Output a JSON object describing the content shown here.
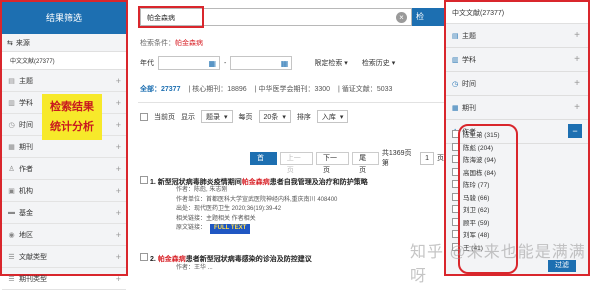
{
  "left": {
    "header": "结果筛选",
    "source_label": "来源",
    "count_label": "中文文献(27377)",
    "facets": [
      {
        "label": "主题",
        "icon": "topic-icon"
      },
      {
        "label": "学科",
        "icon": "book-icon"
      },
      {
        "label": "时间",
        "icon": "clock-icon"
      },
      {
        "label": "期刊",
        "icon": "journal-icon"
      },
      {
        "label": "作者",
        "icon": "person-icon"
      },
      {
        "label": "机构",
        "icon": "building-icon"
      },
      {
        "label": "基金",
        "icon": "fund-icon"
      },
      {
        "label": "地区",
        "icon": "location-icon"
      },
      {
        "label": "文献类型",
        "icon": "doc-icon"
      },
      {
        "label": "期刊类型",
        "icon": "doc-icon"
      }
    ],
    "annotation_line1": "检索结果",
    "annotation_line2": "统计分析"
  },
  "center": {
    "search_value": "帕金森病",
    "search_button": "检",
    "condition_prefix": "检索条件：",
    "condition_value": "帕金森病",
    "year_label": "年代",
    "year_dash": "-",
    "limit_label": "限定检索",
    "history_label": "检索历史",
    "stats": [
      {
        "label": "全部：",
        "value": "27377"
      },
      {
        "label": "核心期刊：",
        "value": "18896"
      },
      {
        "label": "中华医学会期刊：",
        "value": "3300"
      },
      {
        "label": "循证文献：",
        "value": "5033"
      }
    ],
    "toolbar": {
      "current_page": "当前页",
      "display": "显示",
      "display_value": "题录",
      "per_page": "每页",
      "per_page_value": "20条",
      "sort": "排序",
      "sort_value": "入库"
    },
    "pager": {
      "first": "首页",
      "prev": "上一页",
      "next": "下一页",
      "last": "尾页",
      "info": "共1369页 第",
      "page_value": "1",
      "page_unit": "页"
    },
    "records": [
      {
        "index": "1.",
        "title_pre": "新型冠状病毒肺炎疫情期间",
        "title_hl": "帕金森病",
        "title_post": "患者自我管理及治疗和防护策略",
        "meta": [
          {
            "k": "作者：",
            "v": "陈彪, 朱志刚"
          },
          {
            "k": "作者单位：",
            "v": "首都医科大学宣武医院神经内科,重庆南川 408400"
          },
          {
            "k": "出处：",
            "v": "现代医药卫生 2020;36(19):39-42"
          },
          {
            "k": "相关链接：",
            "v": "主题相关    作者相关"
          },
          {
            "k": "原文链接：",
            "v": ""
          }
        ],
        "pdf_label": "FULL TEXT"
      },
      {
        "index": "2.",
        "title_pre": "",
        "title_hl": "帕金森病",
        "title_post": "患者新型冠状病毒感染的诊治及防控建议",
        "meta": [
          {
            "k": "作者：",
            "v": "王华 ..."
          }
        ],
        "pdf_label": ""
      }
    ]
  },
  "right": {
    "title": "中文文献(27377)",
    "facets": [
      {
        "label": "主题",
        "icon": "topic-icon"
      },
      {
        "label": "学科",
        "icon": "book-icon"
      },
      {
        "label": "时间",
        "icon": "clock-icon"
      },
      {
        "label": "期刊",
        "icon": "journal-icon"
      },
      {
        "label": "作者",
        "icon": "person-icon"
      }
    ],
    "authors": [
      "陈生弟 (315)",
      "陈彪 (204)",
      "陈海波 (94)",
      "高国栋 (84)",
      "陈玲 (77)",
      "马骏 (66)",
      "刘卫 (62)",
      "顾平 (59)",
      "刘军 (48)",
      "王 (41)"
    ],
    "filter_button": "过滤"
  },
  "watermark": "知乎 @未来也能是满满呀"
}
